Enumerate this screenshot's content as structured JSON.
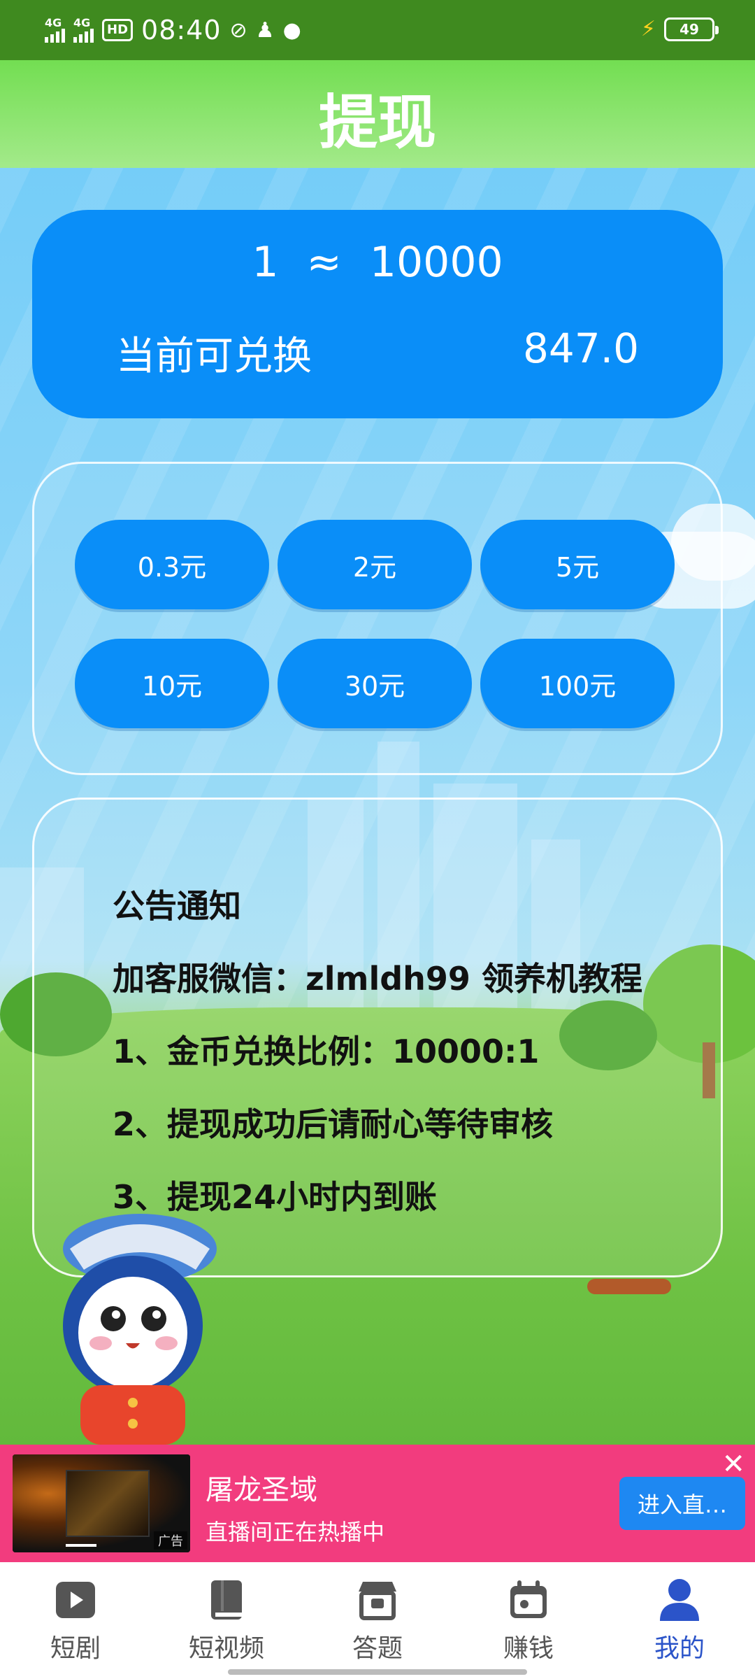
{
  "status_bar": {
    "signal1": "4G",
    "signal2": "4G",
    "hd": "HD",
    "time": "08:40",
    "battery": "49"
  },
  "header": {
    "title": "提现"
  },
  "rate_card": {
    "left": "1",
    "symbol": "≈",
    "right": "10000",
    "available_label": "当前可兑换",
    "available_value": "847.0"
  },
  "amounts": [
    "0.3元",
    "2元",
    "5元",
    "10元",
    "30元",
    "100元"
  ],
  "notice": {
    "title": "公告通知",
    "lines": [
      "加客服微信：zlmldh99 领养机教程",
      "1、金币兑换比例：10000:1",
      "2、提现成功后请耐心等待审核",
      "3、提现24小时内到账"
    ]
  },
  "ad": {
    "title": "屠龙圣域",
    "subtitle": "直播间正在热播中",
    "cta": "进入直…",
    "tag": "广告",
    "close": "✕"
  },
  "nav": [
    {
      "label": "短剧",
      "icon": "play-icon"
    },
    {
      "label": "短视频",
      "icon": "book-icon"
    },
    {
      "label": "答题",
      "icon": "store-icon"
    },
    {
      "label": "赚钱",
      "icon": "calendar-icon"
    },
    {
      "label": "我的",
      "icon": "user-icon",
      "active": true
    }
  ],
  "colors": {
    "accent": "#0a8ef8",
    "nav_active": "#2b54c9",
    "ad_bg": "#f23c7e"
  }
}
